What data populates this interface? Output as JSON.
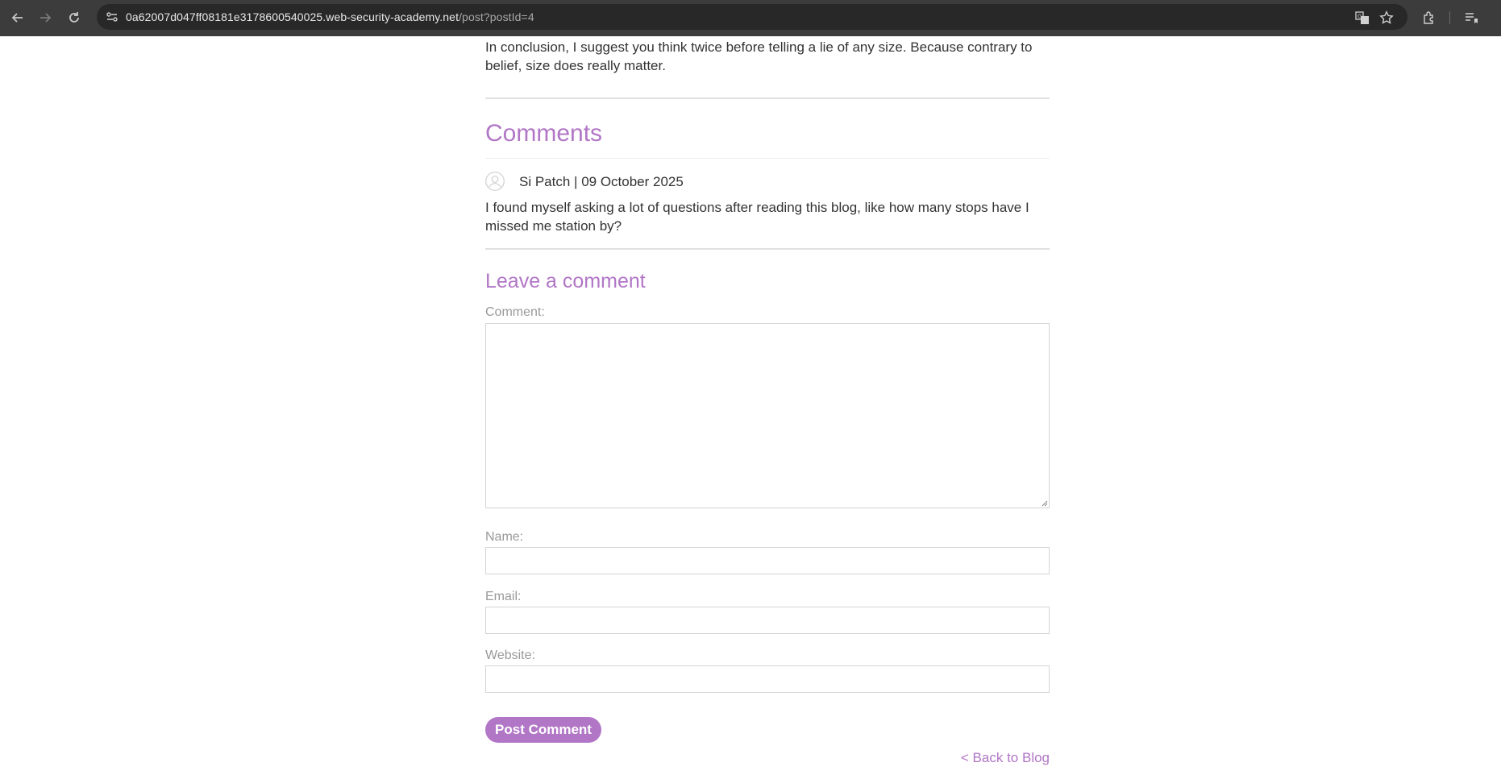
{
  "browser": {
    "url_host": "0a62007d047ff08181e3178600540025.web-security-academy.net",
    "url_path": "/post?postId=4",
    "icons": [
      "back-arrow-icon",
      "forward-arrow-icon",
      "reload-icon",
      "site-info-icon",
      "translate-icon",
      "bookmark-star-icon",
      "extensions-icon",
      "reading-list-icon"
    ]
  },
  "post": {
    "conclusion": "In conclusion, I suggest you think twice before telling a lie of any size. Because contrary to belief, size does really matter."
  },
  "comments": {
    "title": "Comments",
    "items": [
      {
        "author": "Si Patch",
        "date": "09 October 2025",
        "separator": " | ",
        "body": "I found myself asking a lot of questions after reading this blog, like how many stops have I missed me station by?"
      }
    ]
  },
  "form": {
    "title": "Leave a comment",
    "comment_label": "Comment:",
    "name_label": "Name:",
    "email_label": "Email:",
    "website_label": "Website:",
    "submit_label": "Post Comment"
  },
  "footer": {
    "back_link": "< Back to Blog"
  },
  "colors": {
    "accent": "#b176c6",
    "chrome_bg": "#3c3c3c",
    "text": "#333333",
    "label": "#999999"
  }
}
